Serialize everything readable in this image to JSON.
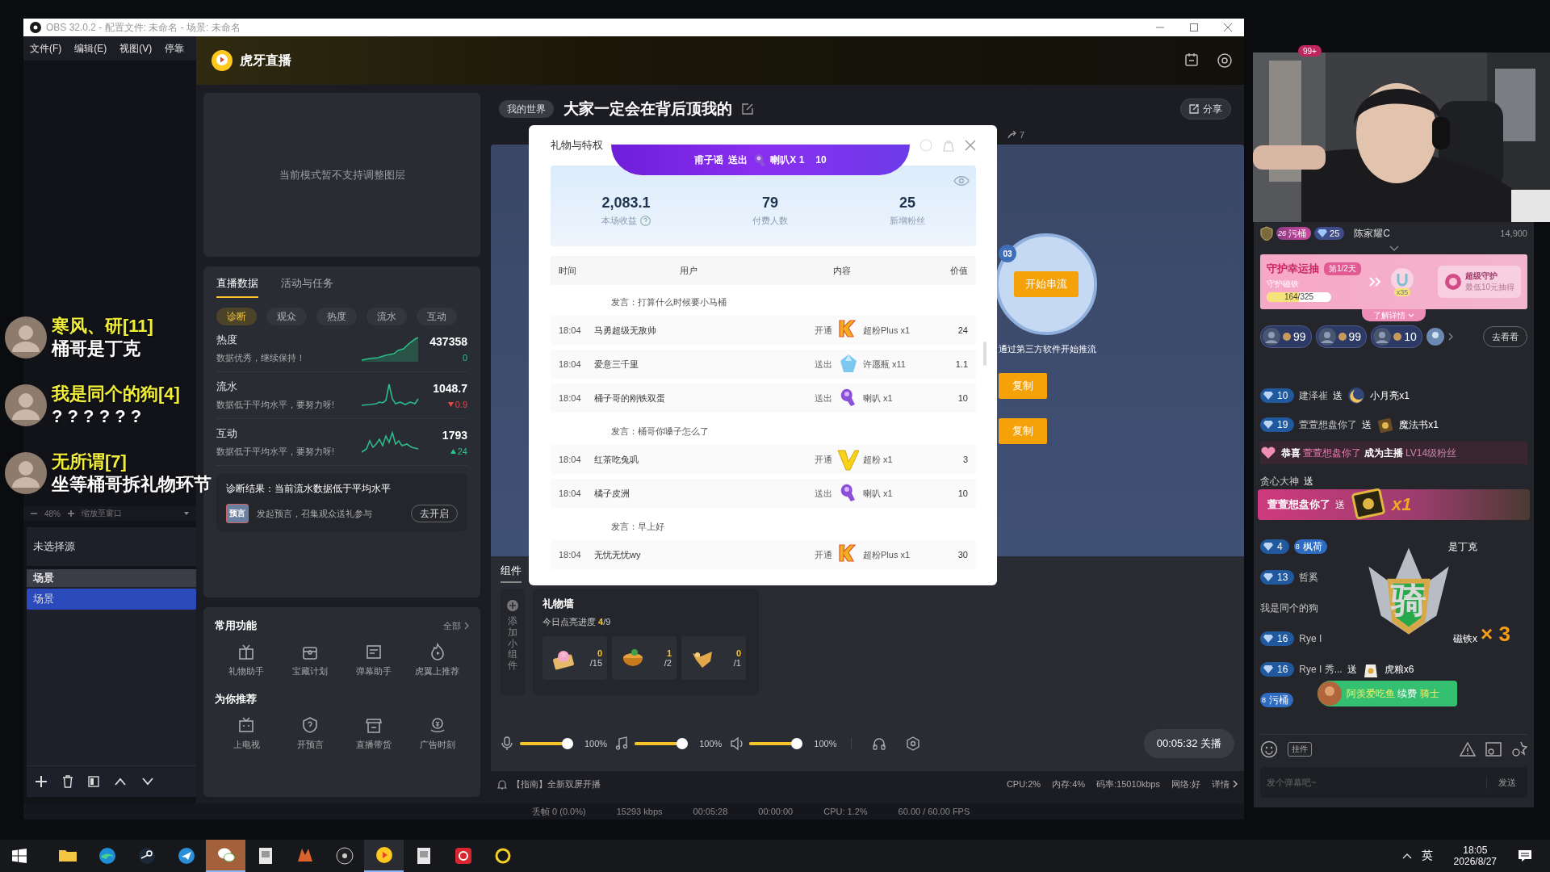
{
  "obs": {
    "title": "OBS 32.0.2 - 配置文件: 未命名 - 场景: 未命名",
    "menu": [
      "文件(F)",
      "编辑(E)",
      "视图(V)",
      "停靠"
    ],
    "zoom": {
      "value": "48%",
      "mode": "缩放至窗口"
    },
    "sources_empty": "未选择源",
    "scenes_title": "场景",
    "scenes": [
      {
        "label": "场景",
        "selected": true
      }
    ],
    "status": [
      "丢帧 0 (0.0%)",
      "15293 kbps",
      "00:05:28",
      "00:00:00",
      "CPU: 1.2%",
      "60.00 / 60.00 FPS"
    ]
  },
  "huya": {
    "brand": "虎牙直播",
    "layer_notice": "当前模式暂不支持调整图层",
    "data_tabs": [
      {
        "label": "直播数据",
        "selected": true
      },
      {
        "label": "活动与任务",
        "selected": false
      }
    ],
    "chips": [
      {
        "label": "诊断",
        "selected": true
      },
      {
        "label": "观众",
        "selected": false
      },
      {
        "label": "热度",
        "selected": false
      },
      {
        "label": "流水",
        "selected": false
      },
      {
        "label": "互动",
        "selected": false
      }
    ],
    "metrics": [
      {
        "name": "热度",
        "note": "数据优秀，继续保持！",
        "value": "437358",
        "delta": "0",
        "kind": "flat"
      },
      {
        "name": "流水",
        "note": "数据低于平均水平，要努力呀!",
        "value": "1048.7",
        "delta": "0.9",
        "kind": "down"
      },
      {
        "name": "互动",
        "note": "数据低于平均水平，要努力呀!",
        "value": "1793",
        "delta": "24",
        "kind": "up"
      }
    ],
    "diagnosis": {
      "result": "诊断结果：当前流水数据低于平均水平",
      "badge": "预言",
      "text": "发起预言，召集观众送礼参与",
      "button": "去开启"
    },
    "functions": {
      "title": "常用功能",
      "more": "全部",
      "items": [
        {
          "label": "礼物助手",
          "kind": "gift"
        },
        {
          "label": "宝藏计划",
          "kind": "chest"
        },
        {
          "label": "弹幕助手",
          "kind": "list"
        },
        {
          "label": "虎翼上推荐",
          "kind": "flame"
        }
      ]
    },
    "recommend": {
      "title": "为你推荐",
      "items": [
        {
          "label": "上电视",
          "kind": "tv"
        },
        {
          "label": "开预言",
          "kind": "question"
        },
        {
          "label": "直播带货",
          "kind": "shop"
        },
        {
          "label": "广告时刻",
          "kind": "coin"
        }
      ]
    },
    "room": {
      "category": "我的世界",
      "title": "大家一定会在背后顶我的",
      "share": "分享",
      "shares": "7"
    },
    "push": {
      "step": "03",
      "button": "开始串流",
      "hint": "通过第三方软件开始推流",
      "copy": [
        "复制",
        "复制"
      ]
    },
    "bottom_tabs": [
      {
        "label": "组件",
        "selected": true
      }
    ],
    "add_widget": "添加小组件",
    "gift_wall": {
      "title": "礼物墙",
      "progress_label": "今日点亮进度",
      "done": "4",
      "total": "/9",
      "items": [
        {
          "count": "0",
          "goal": "/15",
          "kind": "lotus"
        },
        {
          "count": "1",
          "goal": "/2",
          "kind": "bowl"
        },
        {
          "count": "0",
          "goal": "/1",
          "kind": "snack"
        }
      ]
    },
    "audio": [
      {
        "kind": "mic",
        "level": 1,
        "reading": "100%"
      },
      {
        "kind": "music",
        "level": 1,
        "reading": "100%"
      },
      {
        "kind": "speaker",
        "level": 1,
        "reading": "100%"
      }
    ],
    "timer": "00:05:32 关播",
    "tip": "【指南】全新双屏开播",
    "stats": [
      "CPU:2%",
      "内存:4%",
      "码率:15010kbps",
      "网络:好"
    ],
    "details": "详情"
  },
  "dialog": {
    "title": "礼物与特权",
    "banner": {
      "sender": "甫子谣",
      "verb": "送出",
      "gift": "喇叭X 1",
      "value": "10"
    },
    "stats": [
      {
        "value": "2,083.1",
        "label": "本场收益",
        "help": true
      },
      {
        "value": "79",
        "label": "付费人数",
        "help": false
      },
      {
        "value": "25",
        "label": "新增粉丝",
        "help": false
      }
    ],
    "columns": [
      "时间",
      "用户",
      "内容",
      "价值"
    ],
    "rows": [
      {
        "kind": "comment",
        "text": "发言：打算什么时候要小马桶"
      },
      {
        "kind": "superfan_plus",
        "time": "18:04",
        "user": "马勇超级无敌帅",
        "action": "开通",
        "item": "超粉Plus x1",
        "value": "24"
      },
      {
        "kind": "wish_bottle",
        "time": "18:04",
        "user": "爱意三千里",
        "action": "送出",
        "item": "许愿瓶 x11",
        "value": "1.1"
      },
      {
        "kind": "horn",
        "time": "18:04",
        "user": "桶子哥的刚铁双蛋",
        "action": "送出",
        "item": "喇叭 x1",
        "value": "10"
      },
      {
        "kind": "comment",
        "text": "发言：桶哥你嗓子怎么了"
      },
      {
        "kind": "superfan",
        "time": "18:04",
        "user": "红茶吃兔叽",
        "action": "开通",
        "item": "超粉 x1",
        "value": "3"
      },
      {
        "kind": "horn",
        "time": "18:04",
        "user": "橘子皮洲",
        "action": "送出",
        "item": "喇叭 x1",
        "value": "10"
      },
      {
        "kind": "comment",
        "text": "发言：早上好"
      },
      {
        "kind": "superfan_plus",
        "time": "18:04",
        "user": "无忧无忧wy",
        "action": "开通",
        "item": "超粉Plus x1",
        "value": "30"
      }
    ]
  },
  "webcam": {
    "kind": "picture",
    "badge": "99+"
  },
  "chat": {
    "host": {
      "level": "26",
      "tag": "污桶",
      "gem": "25",
      "name": "陈家耀C",
      "score": "14,900"
    },
    "guard": {
      "title": "守护幸运抽",
      "day": "第1/2天",
      "label": "守护磁铁",
      "progress": "164/325",
      "level": 0.505,
      "multiplier": "x35",
      "tier": "超级守护",
      "tier_note": "最低10元抽得",
      "more": "了解详情"
    },
    "viewers": [
      {
        "count": "99"
      },
      {
        "count": "99"
      },
      {
        "count": "10"
      }
    ],
    "viewers_more": "去看看",
    "messages": [
      {
        "kind": "moon_gift",
        "lv": "10",
        "user": "建泽崔",
        "verb": "送",
        "gift": "小月亮x1"
      },
      {
        "kind": "book_gift",
        "lv": "19",
        "user": "萱萱想盘你了",
        "verb": "送",
        "gift": "魔法书x1"
      },
      {
        "kind": "notice",
        "lead": "恭喜",
        "user": "萱萱想盘你了",
        "mid": "成为主播",
        "tail": "LV14级粉丝"
      },
      {
        "kind": "plain",
        "user": "贪心大神",
        "verb": "送"
      },
      {
        "kind": "partial",
        "lv": "4",
        "tag_level": "8",
        "tag": "枫荷",
        "tail": "是丁克"
      },
      {
        "kind": "partial",
        "lv": "13",
        "user": "哲奚"
      },
      {
        "kind": "plain",
        "user": "我是同个的狗"
      },
      {
        "kind": "partial",
        "lv": "16",
        "user": "Rye I",
        "tail": "磁铁x"
      },
      {
        "kind": "bag_gift",
        "lv": "16",
        "user": "Rye I 秀...",
        "verb": "送",
        "gift": "虎粮x6"
      },
      {
        "kind": "partial",
        "tag_level": "8",
        "tag": "污桶"
      }
    ],
    "gift_banner": {
      "user": "萱萱想盘你了",
      "verb": "送",
      "count": "x1"
    },
    "medal": {
      "glyph": "骑",
      "multiplier": "× 3"
    },
    "renew_banner": {
      "user": "阿羡爱吃鱼",
      "action": "续费",
      "tier": "骑士"
    },
    "pendant": "挂件",
    "placeholder": "发个弹幕吧~",
    "send": "发送"
  },
  "overlay_chat": [
    {
      "name": "寒风、研[11]",
      "text": "桶哥是丁克"
    },
    {
      "name": "我是同个的狗[4]",
      "text": "? ? ? ? ? ?"
    },
    {
      "name": "无所谓[7]",
      "text": "坐等桶哥拆礼物环节"
    }
  ],
  "taskbar": {
    "apps": [
      {
        "kind": "folder",
        "active": false
      },
      {
        "kind": "edge",
        "active": false
      },
      {
        "kind": "steam",
        "active": false
      },
      {
        "kind": "bird",
        "active": false
      },
      {
        "kind": "wechat",
        "active": true
      },
      {
        "kind": "doc",
        "active": false
      },
      {
        "kind": "fox",
        "active": false
      },
      {
        "kind": "obs",
        "active": false
      },
      {
        "kind": "huya",
        "active": true
      },
      {
        "kind": "doc",
        "active": false
      },
      {
        "kind": "music",
        "active": false
      },
      {
        "kind": "ring",
        "active": false
      }
    ],
    "ime": "英",
    "time": "18:05",
    "date": "2026/8/27"
  }
}
